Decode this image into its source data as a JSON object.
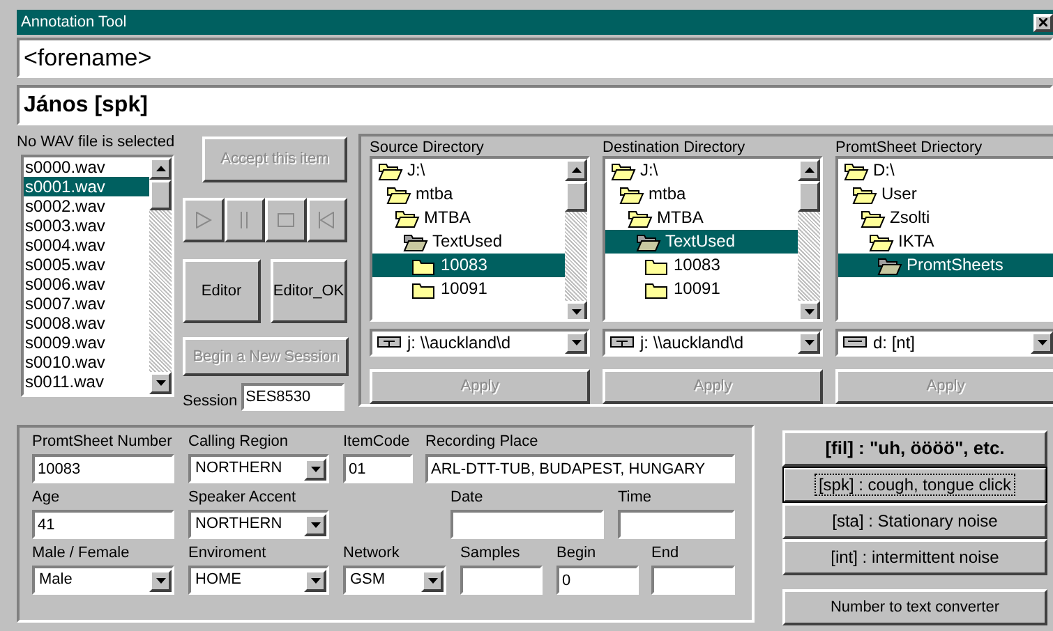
{
  "window": {
    "title": "Annotation Tool"
  },
  "forename_field": {
    "value": "<forename>"
  },
  "transcript_field": {
    "value": "János [spk]"
  },
  "wav_status": "No WAV file is selected",
  "wav_files": [
    {
      "name": "s0000.wav",
      "selected": false
    },
    {
      "name": "s0001.wav",
      "selected": true
    },
    {
      "name": "s0002.wav",
      "selected": false
    },
    {
      "name": "s0003.wav",
      "selected": false
    },
    {
      "name": "s0004.wav",
      "selected": false
    },
    {
      "name": "s0005.wav",
      "selected": false
    },
    {
      "name": "s0006.wav",
      "selected": false
    },
    {
      "name": "s0007.wav",
      "selected": false
    },
    {
      "name": "s0008.wav",
      "selected": false
    },
    {
      "name": "s0009.wav",
      "selected": false
    },
    {
      "name": "s0010.wav",
      "selected": false
    },
    {
      "name": "s0011.wav",
      "selected": false
    }
  ],
  "accept_button": {
    "label": "Accept this item",
    "disabled": true
  },
  "media_controls": [
    {
      "kind": "play",
      "disabled": true
    },
    {
      "kind": "pause",
      "disabled": true
    },
    {
      "kind": "stop",
      "disabled": true
    },
    {
      "kind": "rewind",
      "disabled": true
    }
  ],
  "editor_buttons": [
    {
      "label": "Editor",
      "disabled": false
    },
    {
      "label": "Editor_OK",
      "disabled": false
    }
  ],
  "new_session_button": {
    "label": "Begin a New Session",
    "disabled": true
  },
  "session": {
    "label": "Session",
    "value": "SES8530"
  },
  "directories": [
    {
      "title": "Source Directory",
      "scrollbar": true,
      "tree": [
        {
          "label": "J:\\",
          "open": true,
          "selected": false,
          "children": [
            {
              "label": "mtba",
              "open": true,
              "selected": false,
              "children": [
                {
                  "label": "MTBA",
                  "open": true,
                  "selected": false,
                  "children": [
                    {
                      "label": "TextUsed",
                      "open": true,
                      "current": true,
                      "selected": false,
                      "children": [
                        {
                          "label": "10083",
                          "open": false,
                          "selected": true
                        },
                        {
                          "label": "10091",
                          "open": false,
                          "selected": false
                        }
                      ]
                    }
                  ]
                }
              ]
            }
          ]
        }
      ],
      "drive": {
        "kind": "network",
        "value": "j: \\\\auckland\\d"
      },
      "apply": {
        "label": "Apply",
        "disabled": true
      }
    },
    {
      "title": "Destination Directory",
      "scrollbar": true,
      "tree": [
        {
          "label": "J:\\",
          "open": true,
          "selected": false,
          "children": [
            {
              "label": "mtba",
              "open": true,
              "selected": false,
              "children": [
                {
                  "label": "MTBA",
                  "open": true,
                  "selected": false,
                  "children": [
                    {
                      "label": "TextUsed",
                      "open": true,
                      "current": true,
                      "selected": true,
                      "children": [
                        {
                          "label": "10083",
                          "open": false,
                          "selected": false
                        },
                        {
                          "label": "10091",
                          "open": false,
                          "selected": false
                        }
                      ]
                    }
                  ]
                }
              ]
            }
          ]
        }
      ],
      "drive": {
        "kind": "network",
        "value": "j: \\\\auckland\\d"
      },
      "apply": {
        "label": "Apply",
        "disabled": true
      }
    },
    {
      "title": "PromtSheet Driectory",
      "scrollbar": false,
      "tree": [
        {
          "label": "D:\\",
          "open": true,
          "selected": false,
          "children": [
            {
              "label": "User",
              "open": true,
              "selected": false,
              "children": [
                {
                  "label": "Zsolti",
                  "open": true,
                  "selected": false,
                  "children": [
                    {
                      "label": "IKTA",
                      "open": true,
                      "selected": false,
                      "children": [
                        {
                          "label": "PromtSheets",
                          "open": true,
                          "current": true,
                          "selected": true
                        }
                      ]
                    }
                  ]
                }
              ]
            }
          ]
        }
      ],
      "drive": {
        "kind": "local",
        "value": "d: [nt]"
      },
      "apply": {
        "label": "Apply",
        "disabled": true
      }
    }
  ],
  "form_rows": [
    [
      {
        "label": "PromtSheet Number",
        "kind": "text",
        "value": "10083"
      },
      {
        "label": "Calling Region",
        "kind": "select",
        "value": "NORTHERN"
      },
      {
        "label": "ItemCode",
        "kind": "text",
        "value": "01"
      },
      {
        "label": "Recording Place",
        "kind": "text",
        "value": "ARL-DTT-TUB, BUDAPEST, HUNGARY"
      }
    ],
    [
      {
        "label": "Age",
        "kind": "text",
        "value": "41"
      },
      {
        "label": "Speaker Accent",
        "kind": "select",
        "value": "NORTHERN"
      },
      {
        "label": "Date",
        "kind": "text"
      },
      {
        "label": "Time",
        "kind": "text"
      }
    ],
    [
      {
        "label": "Male / Female",
        "kind": "select",
        "value": "Male"
      },
      {
        "label": "Enviroment",
        "kind": "select",
        "value": "HOME"
      },
      {
        "label": "Network",
        "kind": "select",
        "value": "GSM"
      },
      {
        "label": "Samples",
        "kind": "text"
      },
      {
        "label": "Begin",
        "kind": "text",
        "value": "0"
      },
      {
        "label": "End",
        "kind": "text"
      }
    ]
  ],
  "noise_buttons": [
    {
      "label": "[fil] : \"uh, öööö\", etc.",
      "bold": true,
      "focused": false
    },
    {
      "label": "[spk] : cough, tongue click",
      "bold": false,
      "focused": true
    },
    {
      "label": "[sta] : Stationary noise",
      "bold": false,
      "focused": false
    },
    {
      "label": "[int] : intermittent noise",
      "bold": false,
      "focused": false
    }
  ],
  "converter_button": {
    "label": "Number to text converter"
  }
}
